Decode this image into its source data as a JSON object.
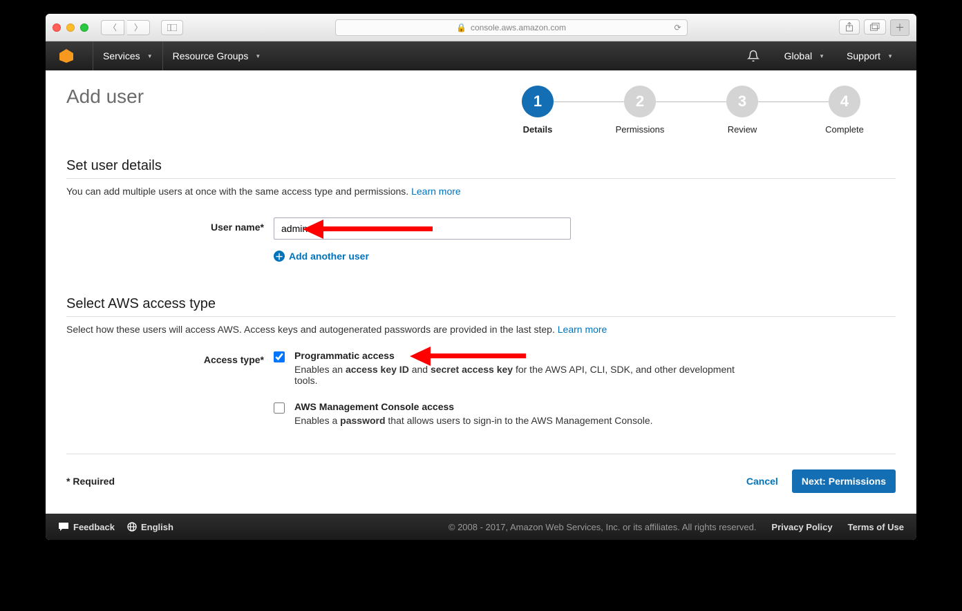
{
  "browser": {
    "url_display": "console.aws.amazon.com"
  },
  "aws_nav": {
    "services": "Services",
    "resource_groups": "Resource Groups",
    "region": "Global",
    "support": "Support"
  },
  "page": {
    "title": "Add user",
    "wizard": [
      {
        "num": "1",
        "label": "Details"
      },
      {
        "num": "2",
        "label": "Permissions"
      },
      {
        "num": "3",
        "label": "Review"
      },
      {
        "num": "4",
        "label": "Complete"
      }
    ],
    "section1": {
      "heading": "Set user details",
      "subtext": "You can add multiple users at once with the same access type and permissions. ",
      "learn_more": "Learn more",
      "username_label": "User name*",
      "username_value": "admin",
      "add_another": "Add another user"
    },
    "section2": {
      "heading": "Select AWS access type",
      "subtext": "Select how these users will access AWS. Access keys and autogenerated passwords are provided in the last step. ",
      "learn_more": "Learn more",
      "access_type_label": "Access type*",
      "opt1": {
        "title": "Programmatic access",
        "desc_pre": "Enables an ",
        "desc_b1": "access key ID",
        "desc_mid": " and ",
        "desc_b2": "secret access key",
        "desc_post": " for the AWS API, CLI, SDK, and other development tools."
      },
      "opt2": {
        "title": "AWS Management Console access",
        "desc_pre": "Enables a ",
        "desc_b1": "password",
        "desc_post": " that allows users to sign-in to the AWS Management Console."
      }
    },
    "required_note": "* Required",
    "cancel": "Cancel",
    "next": "Next: Permissions"
  },
  "footer": {
    "feedback": "Feedback",
    "language": "English",
    "copyright": "© 2008 - 2017, Amazon Web Services, Inc. or its affiliates. All rights reserved.",
    "privacy": "Privacy Policy",
    "terms": "Terms of Use"
  }
}
